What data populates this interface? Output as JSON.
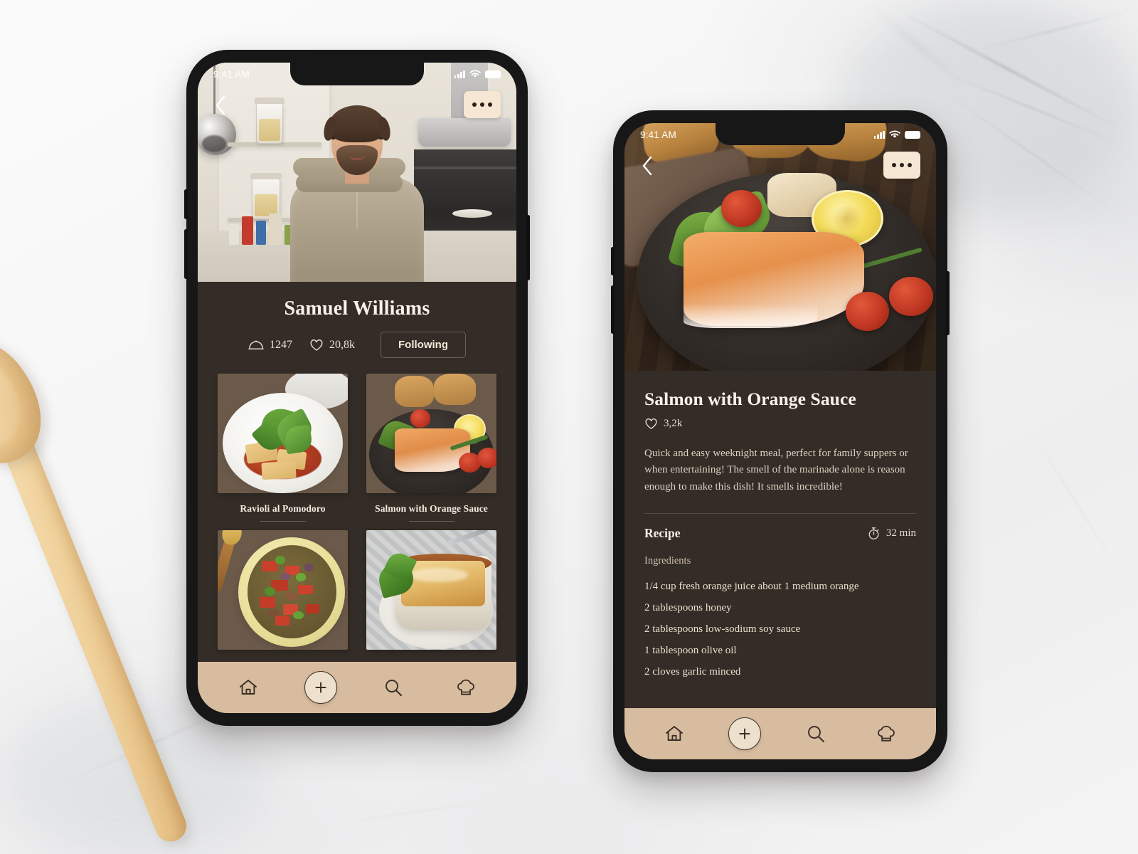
{
  "background": {
    "scene": "marble-countertop",
    "props": [
      "wooden-spoon"
    ],
    "colors": {
      "marble": "#f6f6f6",
      "spoon": "#efcf98"
    }
  },
  "theme": {
    "app_dark": "#342c26",
    "nav_tan": "#d8bc9f",
    "cream_text": "#f7f1e8",
    "muted_text": "#ddd2c3",
    "button_cream": "#f6e6d4",
    "device_frame": "#171717"
  },
  "phones": [
    {
      "id": "profile-screen",
      "status_bar": {
        "time": "9:41 AM",
        "signal_icon": "cellular-bars-icon",
        "wifi_icon": "wifi-icon",
        "battery_icon": "battery-icon"
      },
      "top_controls": {
        "back_icon": "chevron-left-icon",
        "more_icon": "more-options-icon"
      },
      "hero": {
        "image": "chef-portrait-in-kitchen",
        "alt": "Chef standing with arms crossed in a kitchen"
      },
      "profile": {
        "name": "Samuel Williams",
        "stats": [
          {
            "icon": "cloche-dish-icon",
            "label": "1247",
            "name": "recipes-count"
          },
          {
            "icon": "heart-icon",
            "label": "20,8k",
            "name": "likes-count"
          }
        ],
        "follow_button": "Following"
      },
      "recipe_grid": [
        {
          "title": "Ravioli al Pomodoro",
          "image": "ravioli-al-pomodoro-photo"
        },
        {
          "title": "Salmon with Orange Sauce",
          "image": "salmon-with-orange-sauce-photo"
        },
        {
          "title": "",
          "image": "tomato-salad-bowl-photo"
        },
        {
          "title": "",
          "image": "baked-lasagna-ramekin-photo"
        }
      ],
      "nav": [
        {
          "icon": "home-icon",
          "name": "nav-home"
        },
        {
          "icon": "plus-circle-icon",
          "name": "nav-add"
        },
        {
          "icon": "search-icon",
          "name": "nav-search"
        },
        {
          "icon": "chef-hat-icon",
          "name": "nav-chef"
        }
      ]
    },
    {
      "id": "recipe-detail-screen",
      "status_bar": {
        "time": "9:41 AM",
        "signal_icon": "cellular-bars-icon",
        "wifi_icon": "wifi-icon",
        "battery_icon": "battery-icon"
      },
      "top_controls": {
        "back_icon": "chevron-left-icon",
        "more_icon": "more-options-icon"
      },
      "hero": {
        "image": "salmon-fillet-on-cast-iron-skillet",
        "alt": "Seared salmon fillet with lemon, tomatoes and greens"
      },
      "detail": {
        "title": "Salmon with Orange Sauce",
        "likes_icon": "heart-icon",
        "likes": "3,2k",
        "description": "Quick and easy weeknight meal, perfect for family suppers or when entertaining! The smell of the marinade alone is reason enough to make this dish! It smells incredible!",
        "recipe_heading": "Recipe",
        "time_icon": "stopwatch-icon",
        "time": "32 min",
        "ingredients_label": "Ingredients",
        "ingredients": [
          "1/4 cup fresh orange juice about 1 medium orange",
          "2 tablespoons honey",
          "2 tablespoons low-sodium soy sauce",
          "1 tablespoon olive oil",
          "2 cloves garlic minced"
        ]
      },
      "nav": [
        {
          "icon": "home-icon",
          "name": "nav-home"
        },
        {
          "icon": "plus-circle-icon",
          "name": "nav-add"
        },
        {
          "icon": "search-icon",
          "name": "nav-search"
        },
        {
          "icon": "chef-hat-icon",
          "name": "nav-chef"
        }
      ]
    }
  ]
}
